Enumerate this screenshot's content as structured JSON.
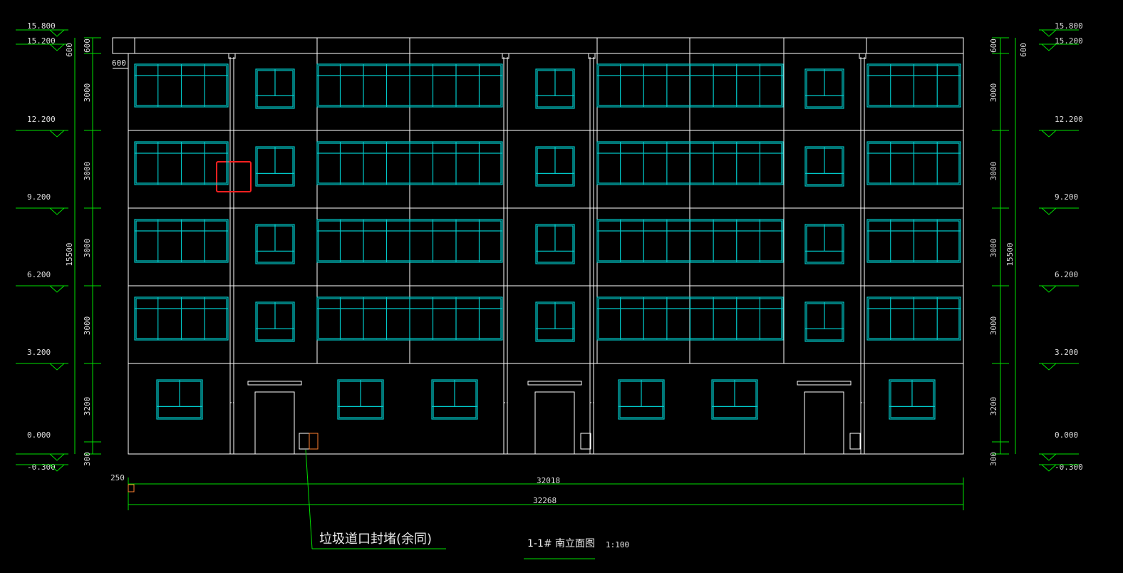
{
  "drawing": {
    "scheme": {
      "background": "#000000",
      "outline": "#ffffff",
      "window": "#00c8c8",
      "dimension": "#00e000",
      "highlight": "#ff2020",
      "marker": "#ff8030"
    },
    "levels": [
      "15.800",
      "15.200",
      "12.200",
      "9.200",
      "6.200",
      "3.200",
      "0.000",
      "-0.300"
    ],
    "segments": [
      "600",
      "3000",
      "3000",
      "3000",
      "3000",
      "3200",
      "300"
    ],
    "overall_height": "15500",
    "parapet_label": "600",
    "parapet_label_inner": "600",
    "base_offset": "250",
    "width_inner": "32018",
    "width_total": "32268",
    "annotation": "垃圾道口封堵(余同)",
    "title": "1-1# 南立面图",
    "scale": "1:100"
  }
}
